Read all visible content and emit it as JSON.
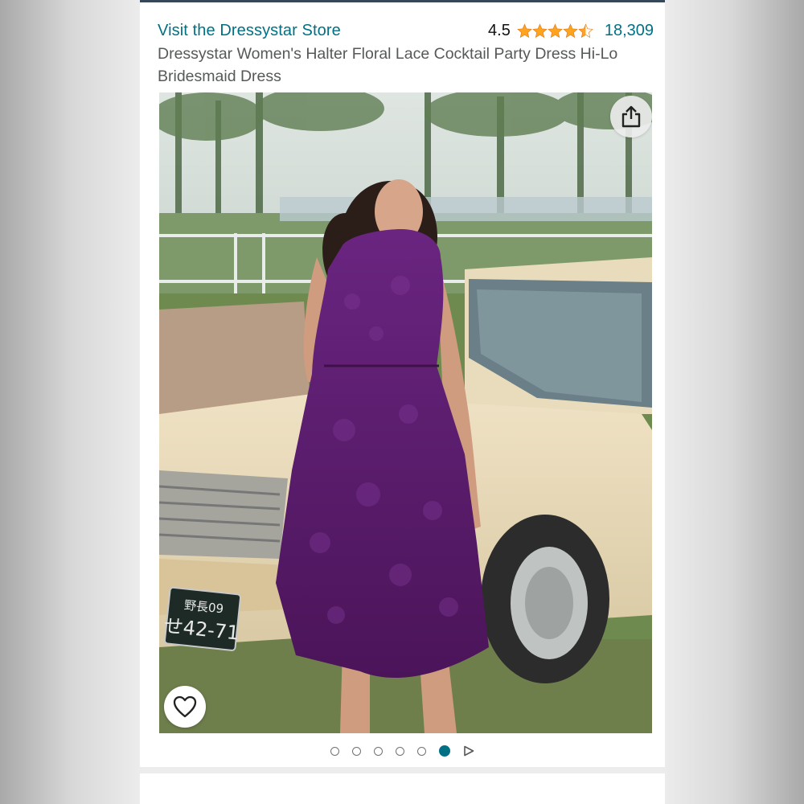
{
  "store": {
    "link_label": "Visit the Dressystar Store"
  },
  "rating": {
    "value": "4.5",
    "stars": 4.5,
    "max_stars": 5,
    "count": "18,309",
    "star_color": "#ffa41c"
  },
  "product": {
    "title": "Dressystar Women's Halter Floral Lace Cocktail Party Dress Hi-Lo Bridesmaid Dress"
  },
  "gallery": {
    "image_alt": "Woman in purple halter floral lace hi-lo dress standing in front of a cream vintage car",
    "plate_line1": "野長09",
    "plate_line2": "せ42-71",
    "total_images": 6,
    "active_index": 5,
    "share_icon": "share-icon",
    "favorite_icon": "heart-icon",
    "next_icon": "play-triangle-icon"
  },
  "colors": {
    "link": "#007185",
    "text_secondary": "#565959",
    "dress": "#5b1c6e",
    "active_dot": "#007185"
  }
}
